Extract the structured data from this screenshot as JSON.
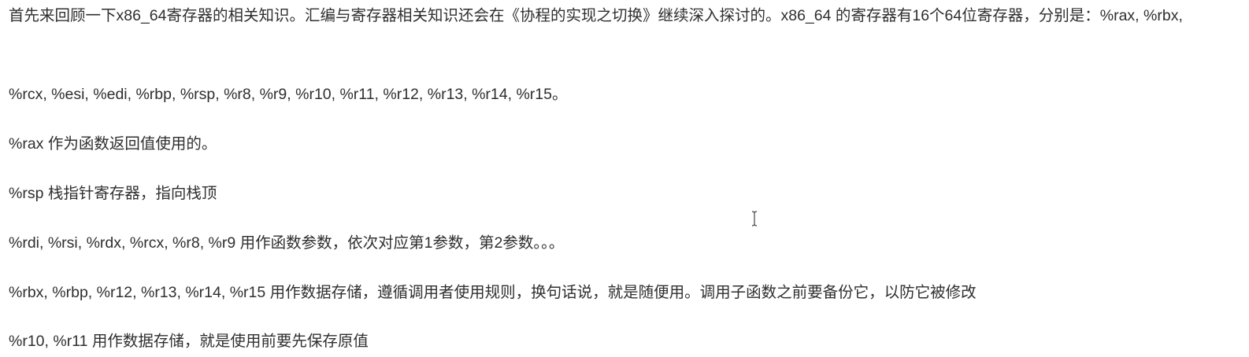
{
  "paragraphs": [
    "首先来回顾一下x86_64寄存器的相关知识。汇编与寄存器相关知识还会在《协程的实现之切换》继续深入探讨的。x86_64 的寄存器有16个64位寄存器，分别是：%rax, %rbx,",
    "%rcx, %esi, %edi, %rbp, %rsp, %r8, %r9, %r10, %r11, %r12, %r13, %r14, %r15。",
    "%rax 作为函数返回值使用的。",
    "%rsp 栈指针寄存器，指向栈顶",
    "%rdi, %rsi, %rdx, %rcx, %r8, %r9 用作函数参数，依次对应第1参数，第2参数。。。",
    "%rbx, %rbp, %r12, %r13, %r14, %r15 用作数据存储，遵循调用者使用规则，换句话说，就是随便用。调用子函数之前要备份它，以防它被修改",
    "%r10, %r11 用作数据存储，就是使用前要先保存原值"
  ],
  "cursor": {
    "icon": "text-cursor-ibeam-icon"
  }
}
